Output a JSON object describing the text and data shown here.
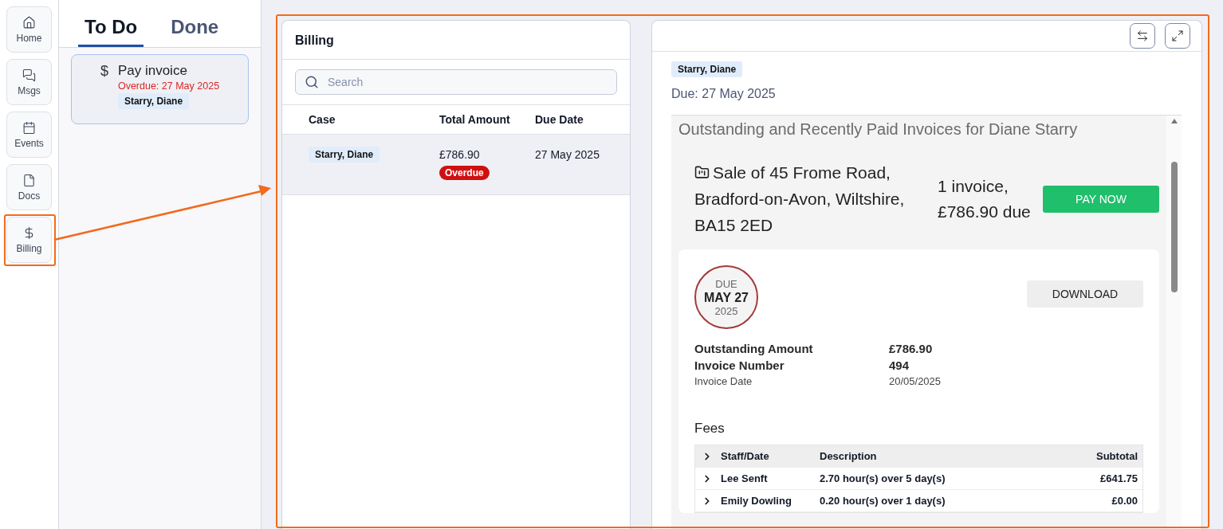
{
  "nav": [
    {
      "kind": "home",
      "label": "Home"
    },
    {
      "kind": "messages",
      "label": "Msgs"
    },
    {
      "kind": "calendar",
      "label": "Events"
    },
    {
      "kind": "document",
      "label": "Docs"
    },
    {
      "kind": "dollar",
      "label": "Billing"
    }
  ],
  "tasks": {
    "tabs": [
      {
        "label": "To Do",
        "selected": true
      },
      {
        "label": "Done",
        "selected": false
      }
    ],
    "items": [
      {
        "icon": "$",
        "title": "Pay invoice",
        "due": "Overdue: 27 May 2025",
        "tag": "Starry, Diane"
      }
    ]
  },
  "billing": {
    "title": "Billing",
    "search": {
      "placeholder": "Search"
    },
    "columns": [
      "Case",
      "Total Amount",
      "Due Date"
    ],
    "rows": [
      {
        "case": "Starry, Diane",
        "amount": "£786.90",
        "badge": "Overdue",
        "due": "27 May 2025",
        "selected": true
      }
    ]
  },
  "detail": {
    "tag": "Starry, Diane",
    "due": "Due: 27 May 2025",
    "statement": {
      "heading": "Outstanding and Recently Paid Invoices for Diane Starry",
      "matter": "Sale of 45 Frome Road, Bradford-on-Avon, Wiltshire, BA15 2ED",
      "summary": "1 invoice, £786.90 due",
      "pay_button": "PAY NOW",
      "invoice": {
        "due_label": "DUE",
        "due_date": "MAY 27",
        "due_year": "2025",
        "download": "DOWNLOAD",
        "fields": [
          {
            "kind": "major",
            "label": "Outstanding Amount",
            "value": "£786.90"
          },
          {
            "kind": "major",
            "label": "Invoice Number",
            "value": "494"
          },
          {
            "kind": "minor",
            "label": "Invoice Date",
            "value": "20/05/2025"
          }
        ],
        "fees": {
          "title": "Fees",
          "columns": [
            "Staff/Date",
            "Description",
            "Subtotal"
          ],
          "rows": [
            {
              "staff": "Lee Senft",
              "description": "2.70 hour(s) over 5 day(s)",
              "subtotal": "£641.75"
            },
            {
              "staff": "Emily Dowling",
              "description": "0.20 hour(s) over 1 day(s)",
              "subtotal": "£0.00"
            }
          ]
        }
      }
    }
  }
}
